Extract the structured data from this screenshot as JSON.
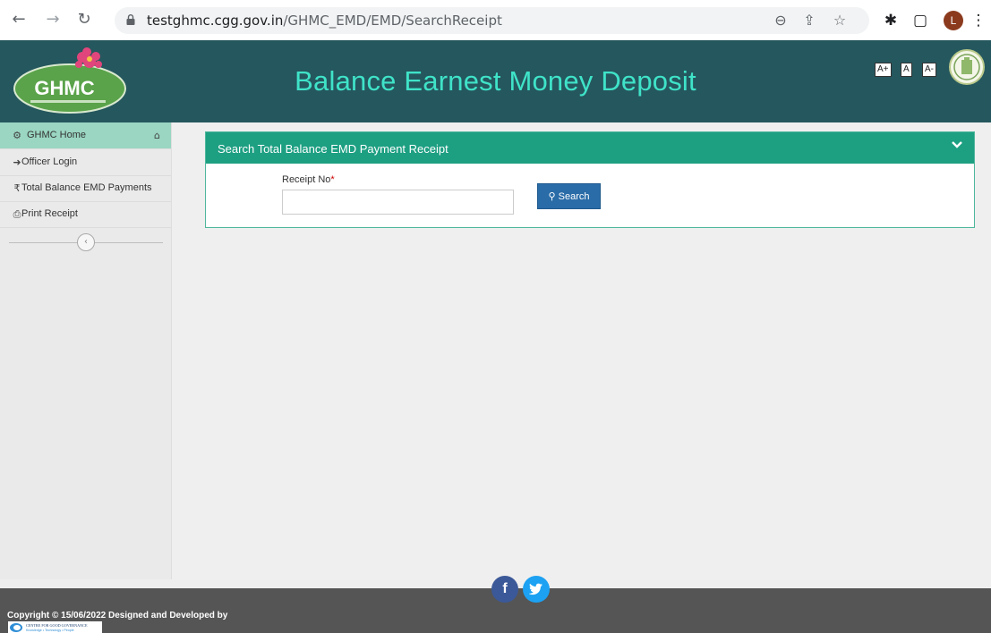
{
  "browser": {
    "url_domain": "testghmc.cgg.gov.in",
    "url_path": "/GHMC_EMD/EMD/SearchReceipt",
    "profile_initial": "L"
  },
  "header": {
    "logo_text": "GHMC",
    "title": "Balance Earnest Money Deposit",
    "font_controls": [
      "A+",
      "A",
      "A-"
    ]
  },
  "sidebar": {
    "items": [
      {
        "label": "GHMC Home",
        "icon": "dashboard-icon",
        "active": true
      },
      {
        "label": "Officer Login",
        "icon": "sign-in-icon"
      },
      {
        "label": "Total Balance EMD Payments",
        "icon": "rupee-icon"
      },
      {
        "label": "Print Receipt",
        "icon": "print-icon"
      }
    ]
  },
  "panel": {
    "title": "Search Total Balance EMD Payment Receipt",
    "field_label": "Receipt No",
    "required_mark": "*",
    "field_value": "",
    "search_label": "Search"
  },
  "footer": {
    "copyright": "Copyright © 15/06/2022 Designed and Developed by",
    "cgg_name": "CENTRE FOR GOOD GOVERNANCE",
    "cgg_tagline": "Knowledge • Technology • People"
  },
  "colors": {
    "header_bg": "#25575e",
    "title_color": "#3fe3c8",
    "panel_head": "#1d9f82",
    "active_item": "#9ad6c2",
    "search_btn": "#2a6ca8",
    "footer_bg": "#555555",
    "facebook": "#3b5998",
    "twitter": "#1da1f2"
  }
}
